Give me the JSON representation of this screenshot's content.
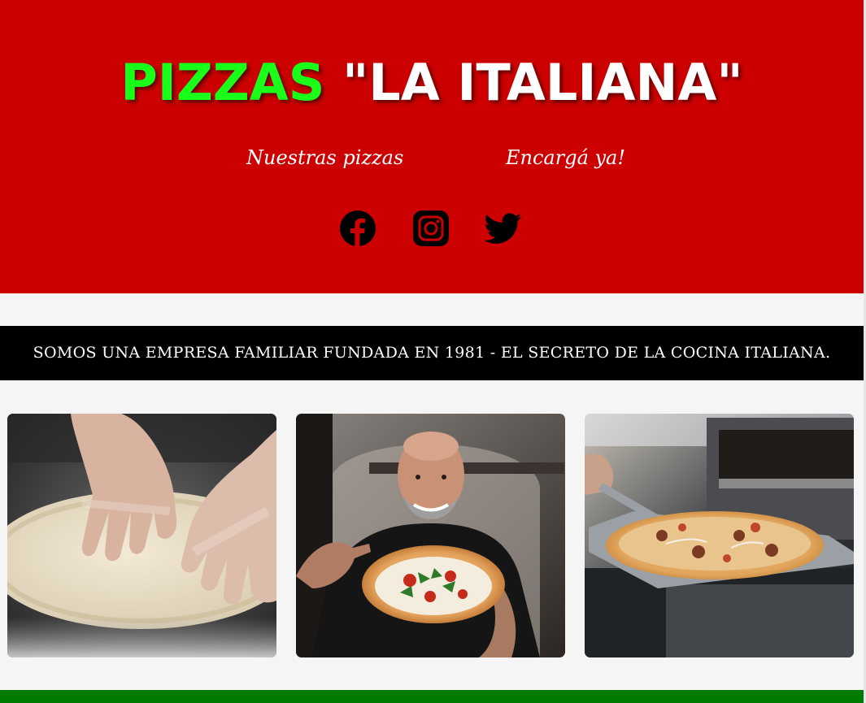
{
  "header": {
    "title_part1": "PIZZAS",
    "title_part2": "\"LA ITALIANA\"",
    "colors": {
      "background": "#cc0000",
      "title_part1": "#19ff19",
      "title_part2": "#ffffff"
    }
  },
  "nav": {
    "items": [
      {
        "label": "Nuestras pizzas"
      },
      {
        "label": "Encargá ya!"
      }
    ]
  },
  "social": {
    "icons": [
      "facebook-icon",
      "instagram-icon",
      "twitter-icon"
    ]
  },
  "banner": {
    "text": "SOMOS UNA EMPRESA FAMILIAR FUNDADA EN 1981 - EL SECRETO DE LA COCINA ITALIANA.",
    "background": "#000000"
  },
  "gallery": {
    "images": [
      "hands kneading pizza dough with flour",
      "smiling chef holding a pizza",
      "pizza on a peel in front of an oven"
    ]
  },
  "footer": {
    "color": "#007a00"
  }
}
